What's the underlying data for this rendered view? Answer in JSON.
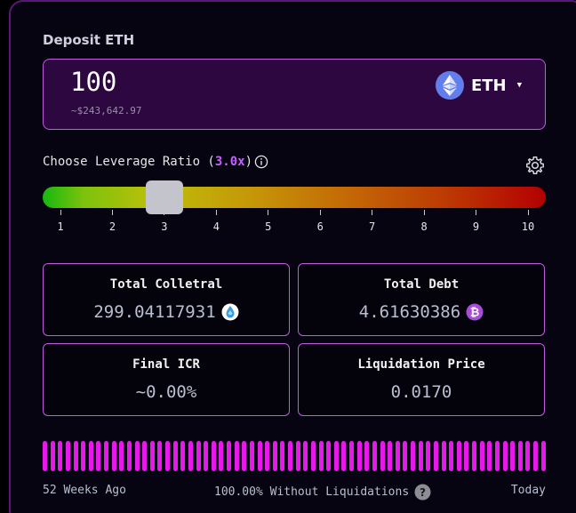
{
  "deposit": {
    "label": "Deposit ETH",
    "amount": "100",
    "usd_value": "~$243,642.97",
    "token": "ETH",
    "token_icon": "ethereum-icon"
  },
  "leverage": {
    "label": "Choose Leverage Ratio (",
    "value": "3.0x",
    "label_close": ")",
    "selected_ratio": 3.0,
    "min": 1,
    "max": 10,
    "ticks": [
      "1",
      "2",
      "3",
      "4",
      "5",
      "6",
      "7",
      "8",
      "9",
      "10"
    ]
  },
  "stats": {
    "total_collateral": {
      "title": "Total Colletral",
      "value": "299.04117931",
      "icon": "staked-eth-icon"
    },
    "total_debt": {
      "title": "Total Debt",
      "value": "4.61630386",
      "icon": "bitcoin-icon"
    },
    "final_icr": {
      "title": "Final ICR",
      "value": "~0.00%"
    },
    "liquidation_price": {
      "title": "Liquidation Price",
      "value": "0.0170"
    }
  },
  "history": {
    "start_label": "52 Weeks Ago",
    "summary": "100.00% Without Liquidations",
    "end_label": "Today",
    "bar_count": 66
  },
  "colors": {
    "accent": "#c05be0",
    "leverage_value": "#c660ff",
    "bar": "#e619ea",
    "deposit_bg": "#2c0740"
  }
}
